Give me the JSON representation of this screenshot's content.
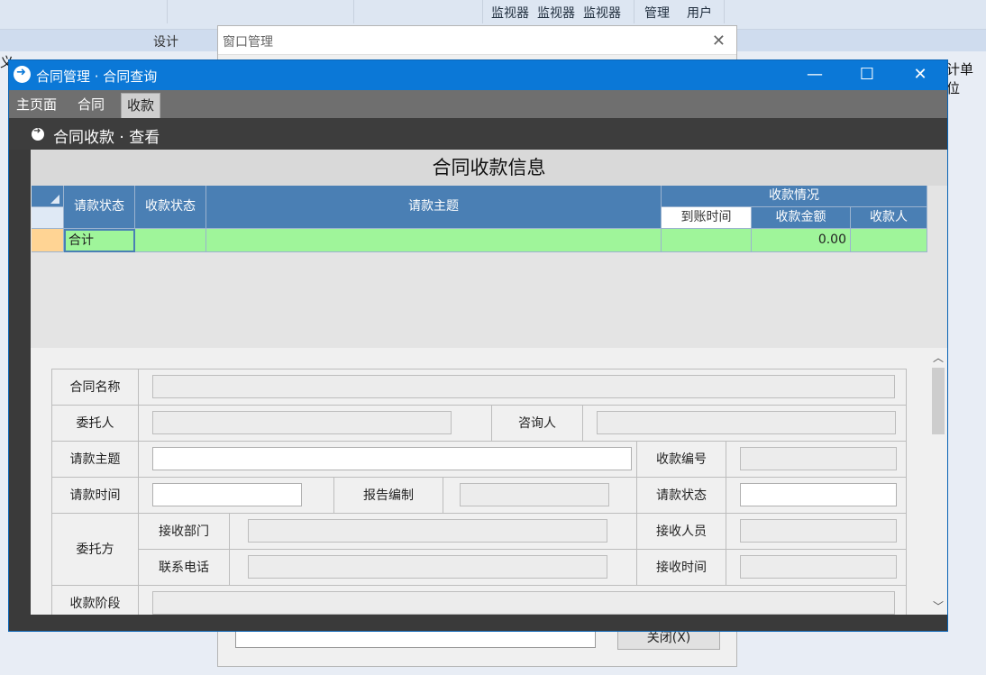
{
  "background_app": {
    "ribbon_items": [
      "监视器",
      "监视器",
      "监视器",
      "管理",
      "用户"
    ],
    "strip_label": "设计",
    "side_left": "义",
    "side_right": "计单位"
  },
  "window_manager": {
    "title": "窗口管理",
    "close_button_label": "关闭(X)"
  },
  "main_window": {
    "title": "合同管理 · 合同查询",
    "tabs": [
      "主页面",
      "合同",
      "收款"
    ],
    "active_tab": "收款",
    "subheader": "合同收款 · 查看"
  },
  "grid": {
    "title": "合同收款信息",
    "columns": {
      "status": "请款状态",
      "receive_status": "收款状态",
      "subject": "请款主题",
      "group": "收款情况",
      "arrival_time": "到账时间",
      "amount": "收款金额",
      "receiver": "收款人"
    },
    "summary_row": {
      "label": "合计",
      "amount": "0.00"
    }
  },
  "form": {
    "contract_name": "合同名称",
    "client": "委托人",
    "consultant": "咨询人",
    "request_subject": "请款主题",
    "receipt_number": "收款编号",
    "request_time": "请款时间",
    "report_author": "报告编制",
    "request_status": "请款状态",
    "client_party": "委托方",
    "receiving_dept": "接收部门",
    "receiving_person": "接收人员",
    "contact_phone": "联系电话",
    "receiving_time": "接收时间",
    "receipt_stage": "收款阶段"
  },
  "colors": {
    "title_bar": "#0b78d7",
    "grid_header": "#4a7fb4",
    "summary_row": "#9ff59a"
  }
}
